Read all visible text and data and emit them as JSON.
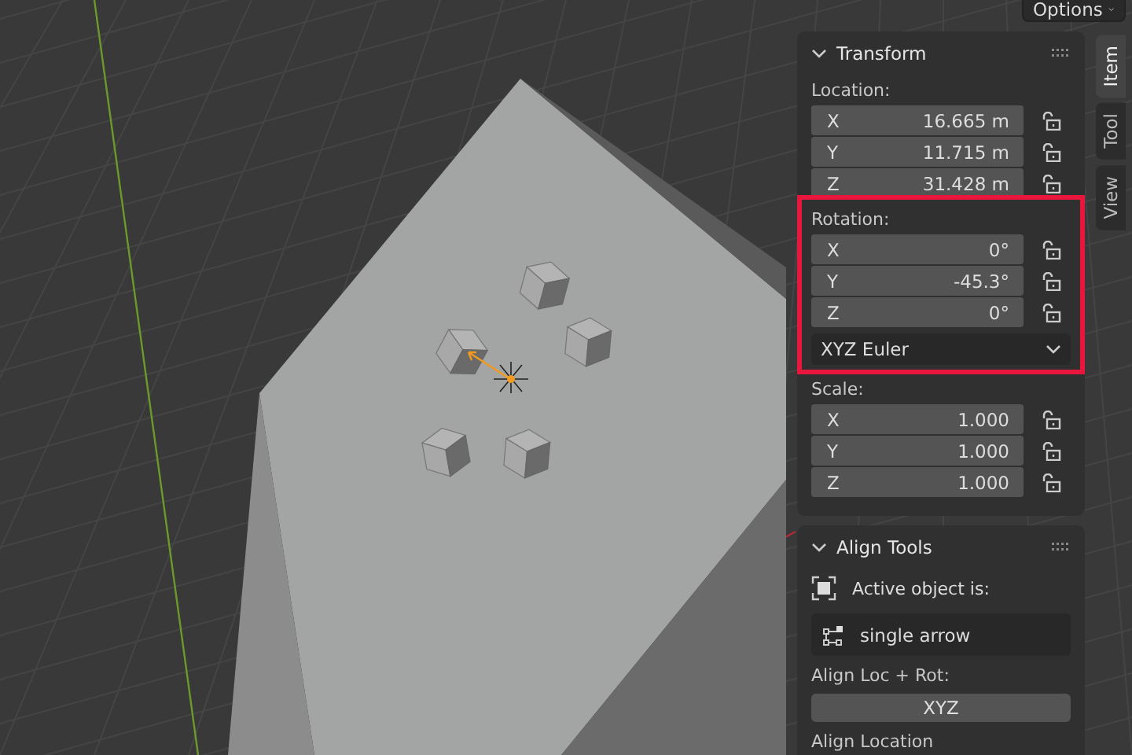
{
  "header": {
    "options_button": "Options"
  },
  "tabs": [
    {
      "label": "Item",
      "selected": true
    },
    {
      "label": "Tool",
      "selected": false
    },
    {
      "label": "View",
      "selected": false
    }
  ],
  "transform": {
    "title": "Transform",
    "expanded": true,
    "groups": [
      {
        "label": "Location:",
        "highlighted": false,
        "fields": [
          {
            "axis": "X",
            "value": "16.665 m"
          },
          {
            "axis": "Y",
            "value": "11.715 m"
          },
          {
            "axis": "Z",
            "value": "31.428 m"
          }
        ]
      },
      {
        "label": "Rotation:",
        "highlighted": true,
        "fields": [
          {
            "axis": "X",
            "value": "0°"
          },
          {
            "axis": "Y",
            "value": "-45.3°"
          },
          {
            "axis": "Z",
            "value": "0°"
          }
        ],
        "mode": "XYZ Euler"
      },
      {
        "label": "Scale:",
        "highlighted": false,
        "fields": [
          {
            "axis": "X",
            "value": "1.000"
          },
          {
            "axis": "Y",
            "value": "1.000"
          },
          {
            "axis": "Z",
            "value": "1.000"
          }
        ]
      }
    ]
  },
  "align_tools": {
    "title": "Align Tools",
    "expanded": true,
    "active_label": "Active object is:",
    "active_object": "single arrow",
    "loc_rot_label": "Align Loc + Rot:",
    "loc_rot_button": "XYZ",
    "location_label": "Align Location"
  }
}
